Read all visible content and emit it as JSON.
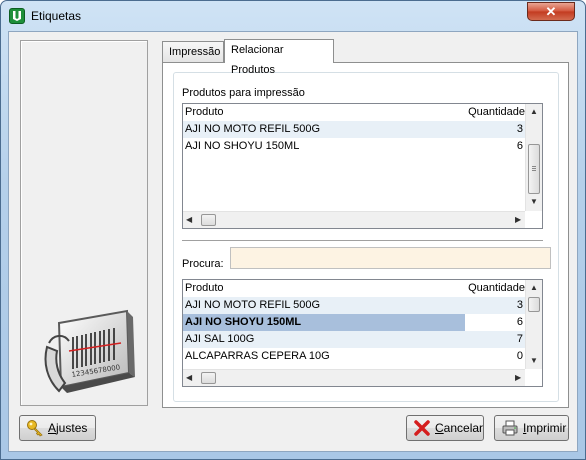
{
  "window": {
    "title": "Etiquetas",
    "close_glyph": "✕"
  },
  "tabs": [
    {
      "label": "Impressão",
      "active": false
    },
    {
      "label": "Relacionar Produtos",
      "active": true
    }
  ],
  "print_list": {
    "title": "Produtos para impressão",
    "columns": {
      "product": "Produto",
      "quantity": "Quantidade"
    },
    "rows": [
      {
        "product": "AJI NO MOTO REFIL 500G",
        "quantity": "3"
      },
      {
        "product": "AJI NO SHOYU 150ML",
        "quantity": "6"
      }
    ]
  },
  "search": {
    "label": "Procura:",
    "value": ""
  },
  "catalog": {
    "columns": {
      "product": "Produto",
      "quantity": "Quantidade"
    },
    "rows": [
      {
        "product": "AJI NO MOTO REFIL 500G",
        "quantity": "3"
      },
      {
        "product": "AJI NO SHOYU 150ML",
        "quantity": "6",
        "selected": true
      },
      {
        "product": "AJI SAL 100G",
        "quantity": "7"
      },
      {
        "product": "ALCAPARRAS CEPERA 10G",
        "quantity": "0"
      }
    ]
  },
  "buttons": {
    "settings_first": "A",
    "settings_rest": "justes",
    "cancel_first": "C",
    "cancel_rest": "ancelar",
    "print_first": "I",
    "print_rest": "mprimir"
  },
  "logo": {
    "barcode_digits": "12345678000"
  },
  "colors": {
    "selection": "#a8bfdc",
    "search_bg": "#fdf3e3",
    "alt_row": "#e8f0f7"
  }
}
